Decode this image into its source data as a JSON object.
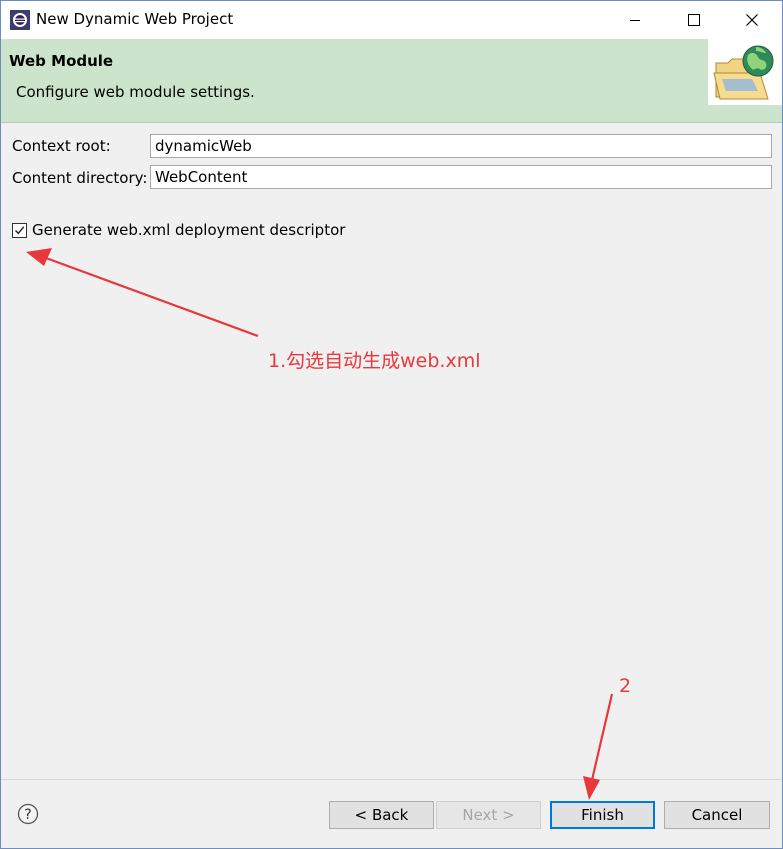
{
  "window": {
    "title": "New Dynamic Web Project",
    "controls": {
      "minimize": "minimize-icon",
      "maximize": "maximize-icon",
      "close": "close-icon"
    }
  },
  "banner": {
    "title": "Web Module",
    "description": "Configure web module settings.",
    "image": "web-folder-globe-icon"
  },
  "form": {
    "context_root_label": "Context root:",
    "context_root_value": "dynamicWeb",
    "content_dir_label": "Content directory:",
    "content_dir_value": "WebContent",
    "generate_label": "Generate web.xml deployment descriptor",
    "generate_checked": true
  },
  "annotations": {
    "step1": "1.勾选自动生成web.xml",
    "step2": "2",
    "color": "#e8383d"
  },
  "footer": {
    "help_icon": "help-icon",
    "back": "< Back",
    "next": "Next >",
    "finish": "Finish",
    "cancel": "Cancel"
  }
}
